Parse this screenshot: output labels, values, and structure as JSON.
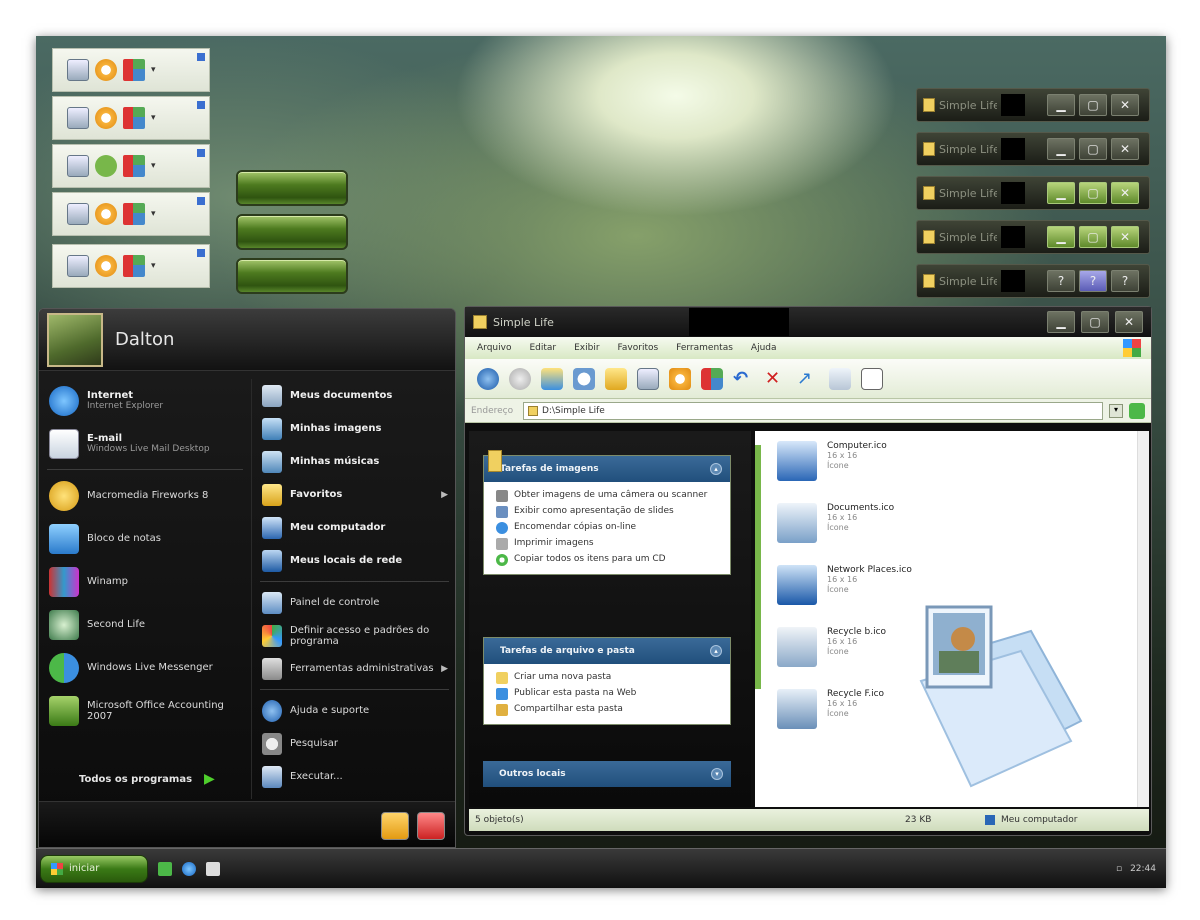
{
  "colors": {
    "accent_green": "#4d7a1f",
    "panel_blue": "#2a5888",
    "menu_bg": "#0d0d0d"
  },
  "titlebars": [
    {
      "title": "Simple Life",
      "buttons": [
        "minimize-icon",
        "maximize-icon",
        "close-icon"
      ],
      "state": "normal"
    },
    {
      "title": "Simple Life",
      "buttons": [
        "minimize-icon",
        "maximize-icon",
        "close-icon"
      ],
      "state": "normal"
    },
    {
      "title": "Simple Life",
      "buttons": [
        "minimize-icon",
        "maximize-icon",
        "close-icon"
      ],
      "state": "hover"
    },
    {
      "title": "Simple Life",
      "buttons": [
        "minimize-icon",
        "maximize-icon",
        "close-icon"
      ],
      "state": "hover"
    },
    {
      "title": "Simple Life",
      "buttons": [
        "help-icon",
        "help-icon",
        "help-icon"
      ],
      "state": "pressed"
    }
  ],
  "start_menu": {
    "user": "Dalton",
    "pinned": [
      {
        "title": "Internet",
        "subtitle": "Internet Explorer",
        "icon": "ie-icon"
      },
      {
        "title": "E-mail",
        "subtitle": "Windows Live Mail Desktop",
        "icon": "mail-icon"
      }
    ],
    "recent": [
      {
        "label": "Macromedia Fireworks 8",
        "icon": "fireworks-icon"
      },
      {
        "label": "Bloco de notas",
        "icon": "notepad-icon"
      },
      {
        "label": "Winamp",
        "icon": "winamp-icon"
      },
      {
        "label": "Second Life",
        "icon": "secondlife-icon"
      },
      {
        "label": "Windows Live Messenger",
        "icon": "messenger-icon"
      },
      {
        "label": "Microsoft Office Accounting 2007",
        "icon": "accounting-icon"
      }
    ],
    "all_programs": "Todos os programas",
    "right": [
      {
        "label": "Meus documentos",
        "bold": true
      },
      {
        "label": "Minhas imagens",
        "bold": true
      },
      {
        "label": "Minhas músicas",
        "bold": true
      },
      {
        "label": "Favoritos",
        "bold": true,
        "arrow": true
      },
      {
        "label": "Meu computador",
        "bold": true
      },
      {
        "label": "Meus locais de rede",
        "bold": true
      },
      {
        "label": "Painel de controle",
        "bold": false
      },
      {
        "label": "Definir acesso e padrões do programa",
        "bold": false
      },
      {
        "label": "Ferramentas administrativas",
        "bold": false,
        "arrow": true
      },
      {
        "label": "Ajuda e suporte",
        "bold": false
      },
      {
        "label": "Pesquisar",
        "bold": false
      },
      {
        "label": "Executar...",
        "bold": false
      }
    ]
  },
  "explorer": {
    "title": "Simple Life",
    "menu": [
      "Arquivo",
      "Editar",
      "Exibir",
      "Favoritos",
      "Ferramentas",
      "Ajuda"
    ],
    "address_label": "Endereço",
    "address": "D:\\Simple Life",
    "tasks": [
      {
        "header": "Tarefas de imagens",
        "items": [
          "Obter imagens de uma câmera ou scanner",
          "Exibir como apresentação de slides",
          "Encomendar cópias on-line",
          "Imprimir imagens",
          "Copiar todos os itens para um CD"
        ]
      },
      {
        "header": "Tarefas de arquivo e pasta",
        "items": [
          "Criar uma nova pasta",
          "Publicar esta pasta na Web",
          "Compartilhar esta pasta"
        ]
      },
      {
        "header": "Outros locais",
        "items": []
      }
    ],
    "files": [
      {
        "name": "Computer.ico",
        "meta1": "16 x 16",
        "meta2": "Ícone"
      },
      {
        "name": "Documents.ico",
        "meta1": "16 x 16",
        "meta2": "Ícone"
      },
      {
        "name": "Network Places.ico",
        "meta1": "16 x 16",
        "meta2": "Ícone"
      },
      {
        "name": "Recycle b.ico",
        "meta1": "16 x 16",
        "meta2": "Ícone"
      },
      {
        "name": "Recycle F.ico",
        "meta1": "16 x 16",
        "meta2": "Ícone"
      }
    ],
    "status": {
      "left": "5 objeto(s)",
      "size": "23 KB",
      "location": "Meu computador"
    }
  },
  "taskbar": {
    "start_label": "iniciar",
    "clock": "22:44"
  }
}
